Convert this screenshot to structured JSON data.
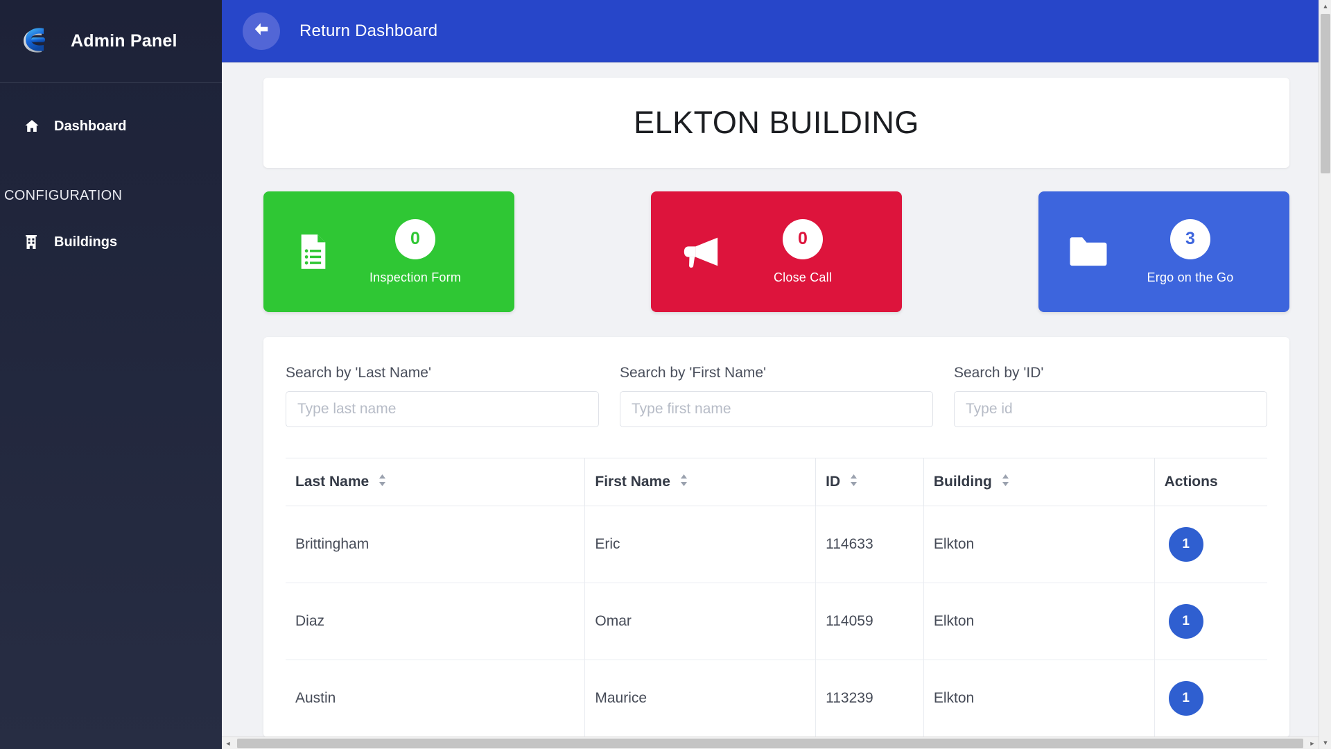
{
  "sidebar": {
    "brand_title": "Admin Panel",
    "logo_icon": "e-logo-icon",
    "items": [
      {
        "label": "Dashboard",
        "icon": "home-icon"
      }
    ],
    "section_title": "CONFIGURATION",
    "config_items": [
      {
        "label": "Buildings",
        "icon": "building-icon"
      }
    ]
  },
  "topbar": {
    "back_icon": "arrow-left-icon",
    "title": "Return Dashboard"
  },
  "page": {
    "title": "ELKTON BUILDING"
  },
  "cards": [
    {
      "count": "0",
      "label": "Inspection Form",
      "color": "#2fc734",
      "icon": "document-list-icon"
    },
    {
      "count": "0",
      "label": "Close Call",
      "color": "#dd143c",
      "icon": "megaphone-icon"
    },
    {
      "count": "3",
      "label": "Ergo on the Go",
      "color": "#3d65dd",
      "icon": "folder-icon"
    }
  ],
  "search": {
    "fields": [
      {
        "label": "Search by 'Last Name'",
        "placeholder": "Type last name",
        "value": ""
      },
      {
        "label": "Search by 'First Name'",
        "placeholder": "Type first name",
        "value": ""
      },
      {
        "label": "Search by 'ID'",
        "placeholder": "Type id",
        "value": ""
      }
    ]
  },
  "table": {
    "columns": [
      {
        "label": "Last Name",
        "sortable": true
      },
      {
        "label": "First Name",
        "sortable": true
      },
      {
        "label": "ID",
        "sortable": true
      },
      {
        "label": "Building",
        "sortable": true
      },
      {
        "label": "Actions",
        "sortable": false
      }
    ],
    "rows": [
      {
        "last_name": "Brittingham",
        "first_name": "Eric",
        "id": "114633",
        "building": "Elkton",
        "action_count": "1"
      },
      {
        "last_name": "Diaz",
        "first_name": "Omar",
        "id": "114059",
        "building": "Elkton",
        "action_count": "1"
      },
      {
        "last_name": "Austin",
        "first_name": "Maurice",
        "id": "113239",
        "building": "Elkton",
        "action_count": "1"
      }
    ]
  },
  "scrollbars": {
    "up_arrow": "▲",
    "down_arrow": "▼",
    "left_arrow": "◄",
    "right_arrow": "►"
  }
}
